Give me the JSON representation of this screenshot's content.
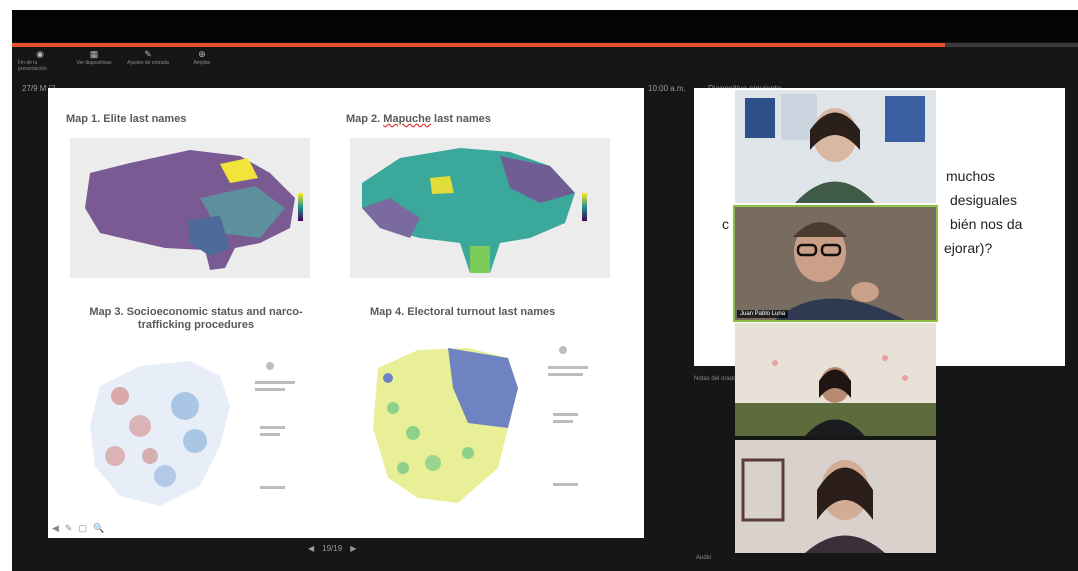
{
  "colors": {
    "progress": "#e5502d",
    "window_bg": "#161616",
    "active_speaker": "#8bbf3f"
  },
  "presentation": {
    "progress_fraction": 0.875,
    "slide_counter": "27/9 M ☑",
    "time": "10:00 a.m.",
    "panel_label": "Diapositiva siguiente",
    "notes_label": "Notas del orador",
    "pager": {
      "prev": "◀",
      "page": "19/19",
      "next": "▶"
    },
    "bottom_label": "Audio",
    "toolbar": [
      {
        "icon": "pointer-icon",
        "glyph": "◉",
        "label": "Fin de la presentación"
      },
      {
        "icon": "grid-icon",
        "glyph": "▦",
        "label": "Ver diapositivas"
      },
      {
        "icon": "pen-icon",
        "glyph": "✎",
        "label": "Ajustes de entrada"
      },
      {
        "icon": "zoom-icon",
        "glyph": "⊕",
        "label": "Ampliar"
      }
    ]
  },
  "slide": {
    "maps": [
      {
        "id": "map1",
        "title": "Map 1. Elite last names"
      },
      {
        "id": "map2",
        "title_pre": "Map 2. ",
        "title_underlined": "Mapuche",
        "title_post": " last names"
      },
      {
        "id": "map3",
        "title": "Map 3. Socioeconomic status and narco-trafficking procedures"
      },
      {
        "id": "map4",
        "title": "Map 4. Electoral turnout last names"
      }
    ],
    "controls": [
      "◀",
      "✎",
      "▢",
      "🔍"
    ]
  },
  "shared_screen": {
    "lines": [
      "muchos",
      "desiguales",
      "c",
      "bién nos da",
      "ejorar)?"
    ]
  },
  "participants": [
    {
      "id": "p1",
      "name": ""
    },
    {
      "id": "p2",
      "name": "Juan Pablo Luna",
      "active": true
    },
    {
      "id": "p3",
      "name": ""
    },
    {
      "id": "p4",
      "name": ""
    }
  ]
}
